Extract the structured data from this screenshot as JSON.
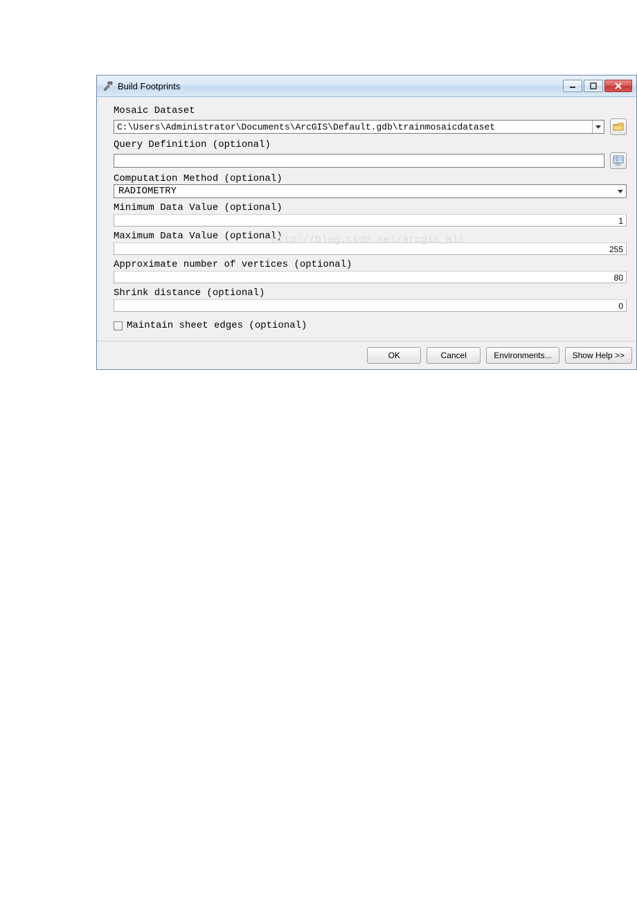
{
  "window": {
    "title": "Build Footprints"
  },
  "form": {
    "mosaic_label": "Mosaic Dataset",
    "mosaic_value": "C:\\Users\\Administrator\\Documents\\ArcGIS\\Default.gdb\\trainmosaicdataset",
    "query_label": "Query Definition (optional)",
    "query_value": "",
    "method_label": "Computation Method (optional)",
    "method_value": "RADIOMETRY",
    "min_label": "Minimum Data Value (optional)",
    "min_value": "1",
    "max_label": "Maximum Data Value (optional)",
    "max_value": "255",
    "verts_label": "Approximate number of vertices (optional)",
    "verts_value": "80",
    "shrink_label": "Shrink distance (optional)",
    "shrink_value": "0",
    "maintain_label": "Maintain sheet edges (optional)"
  },
  "buttons": {
    "ok": "OK",
    "cancel": "Cancel",
    "env": "Environments...",
    "help": "Show Help >>"
  },
  "watermark": "http://blog.csdn.net/arcgis_all"
}
